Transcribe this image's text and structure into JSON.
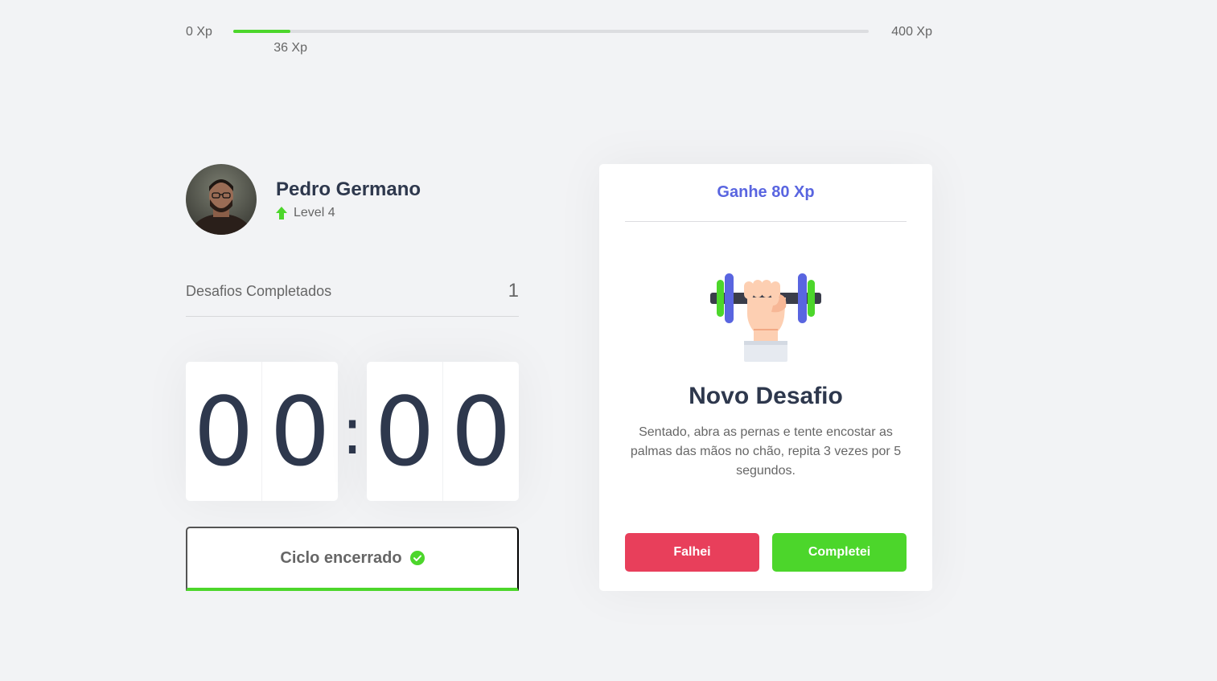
{
  "experience": {
    "min_label": "0 Xp",
    "max_label": "400 Xp",
    "current_label": "36 Xp",
    "current_value": 36,
    "max_value": 400
  },
  "profile": {
    "name": "Pedro Germano",
    "level_label": "Level 4",
    "avatar_icon": "user-photo"
  },
  "stats": {
    "completed_label": "Desafios Completados",
    "completed_value": "1"
  },
  "countdown": {
    "minute_left": "0",
    "minute_right": "0",
    "separator": ":",
    "second_left": "0",
    "second_right": "0"
  },
  "cycle": {
    "label": "Ciclo encerrado",
    "icon": "check-circle-icon"
  },
  "challenge": {
    "reward_label": "Ganhe 80 Xp",
    "title": "Novo Desafio",
    "description": "Sentado, abra as pernas e tente encostar as palmas das mãos no chão, repita 3 vezes por 5 segundos.",
    "icon": "dumbbell-icon",
    "fail_label": "Falhei",
    "success_label": "Completei"
  },
  "colors": {
    "background": "#f2f3f5",
    "green": "#4cd62b",
    "red": "#e83f5b",
    "blue": "#5965e0",
    "title": "#2e384d",
    "text": "#666666"
  }
}
